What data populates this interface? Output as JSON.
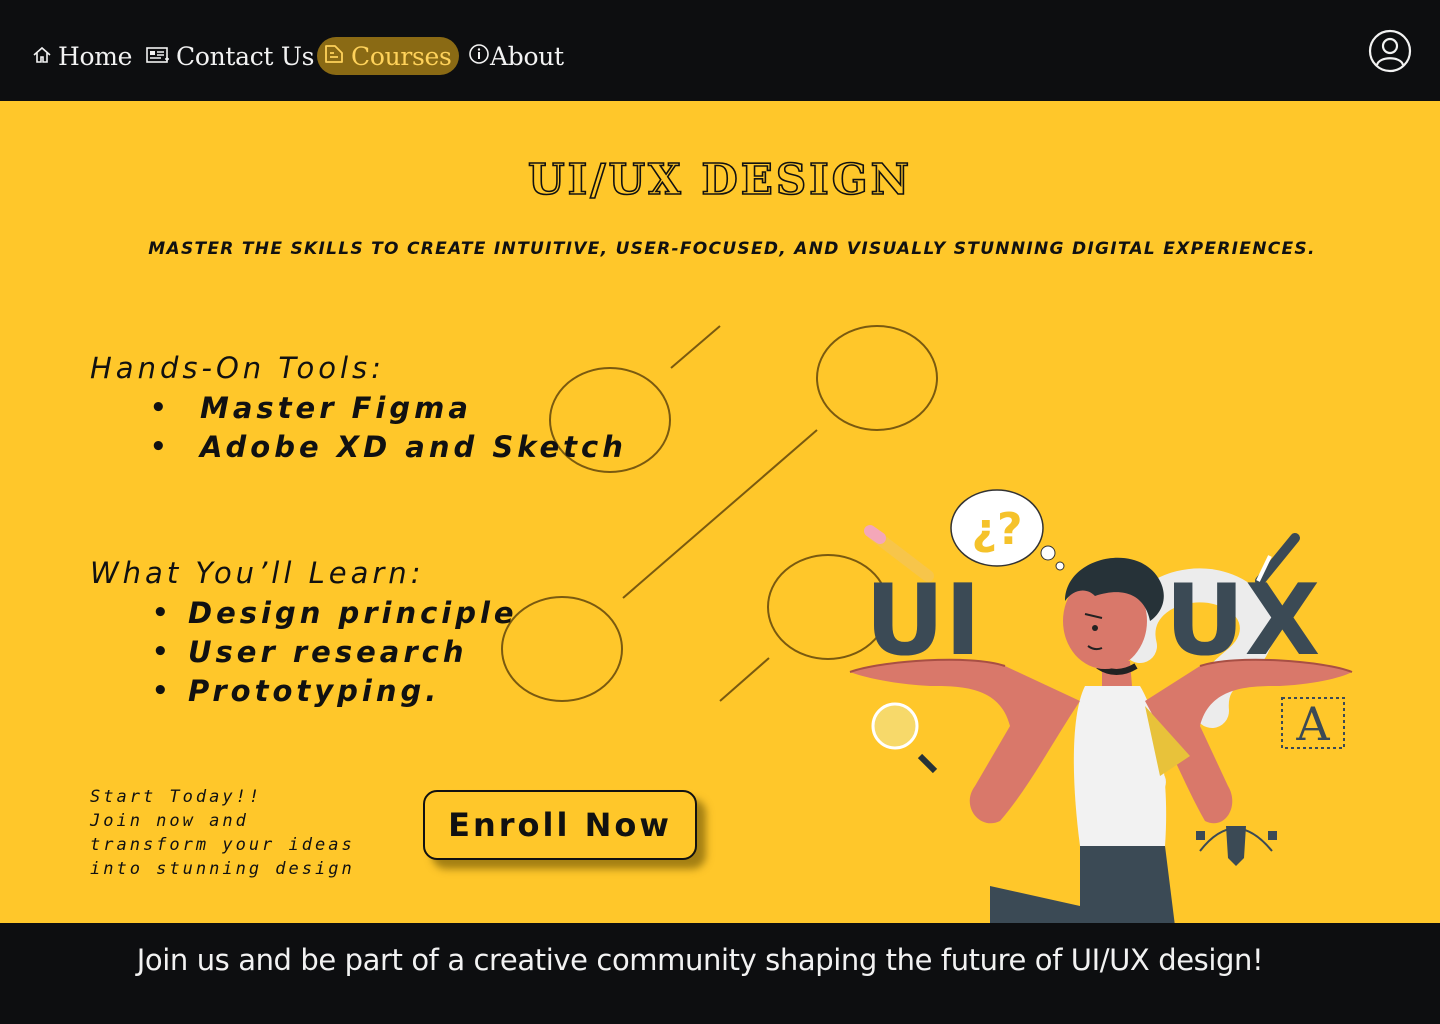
{
  "nav": {
    "home": "Home",
    "contact": "Contact Us",
    "courses": "Courses",
    "about": "About"
  },
  "icons": {
    "home": "home-icon",
    "contact": "contact-card-icon",
    "courses": "courses-icon",
    "about": "info-icon",
    "user": "user-icon"
  },
  "hero": {
    "title": "UI/UX DESIGN",
    "subtitle": "Master the skills to create intuitive, user-focused, and visually stunning digital experiences.",
    "tools_heading": "Hands-On Tools:",
    "tools": [
      "Master Figma",
      "Adobe XD and Sketch"
    ],
    "learn_heading": "What You’ll Learn:",
    "learn": [
      "Design principle",
      "User research",
      "Prototyping."
    ],
    "start_line1": "Start Today!!",
    "start_line2": "Join now and  transform your ideas into stunning design",
    "enroll": "Enroll Now"
  },
  "illustration": {
    "ui": "UI",
    "ux": "UX",
    "bubble": "¿?",
    "glyph": "A"
  },
  "footer": {
    "text": "Join us and be part of a creative community shaping the future of UI/UX design!"
  },
  "colors": {
    "accent": "#ffc72a",
    "dark": "#0d0e10",
    "active_tab": "#8a6a14"
  }
}
